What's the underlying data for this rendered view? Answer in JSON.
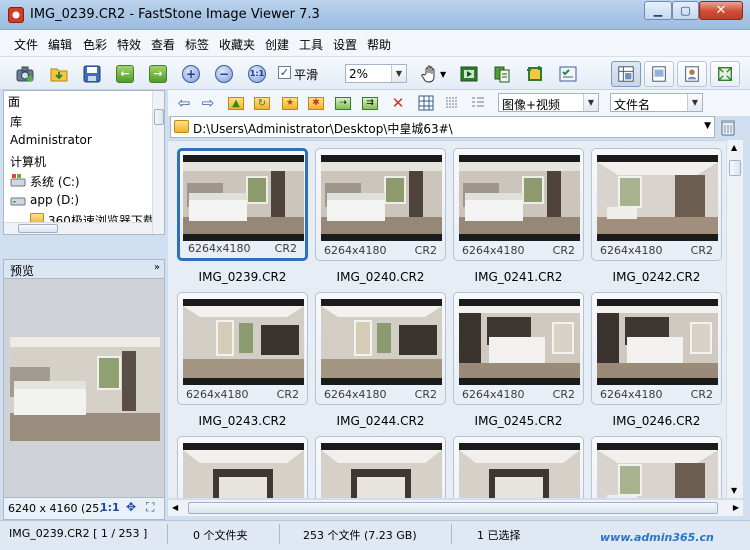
{
  "window": {
    "title": "IMG_0239.CR2  -  FastStone Image Viewer 7.3",
    "min_glyph": "▁",
    "max_glyph": "▢",
    "close_glyph": "✕"
  },
  "menu": [
    "文件",
    "编辑",
    "色彩",
    "特效",
    "查看",
    "标签",
    "收藏夹",
    "创建",
    "工具",
    "设置",
    "帮助"
  ],
  "toolbar": {
    "smooth_label": "平滑",
    "smooth_checked": true,
    "zoom_value": "2%",
    "zoom_fit_label": "1:1"
  },
  "tree": {
    "items": [
      {
        "label": "面",
        "icon": "none"
      },
      {
        "label": "库",
        "icon": "none"
      },
      {
        "label": "Administrator",
        "icon": "none"
      },
      {
        "label": "计算机",
        "icon": "none"
      },
      {
        "label": "系统 (C:)",
        "icon": "windows-drive-icon"
      },
      {
        "label": "app (D:)",
        "icon": "drive-icon"
      },
      {
        "label": "360极速浏览器下载",
        "icon": "folder-icon"
      }
    ]
  },
  "preview": {
    "header": "预览",
    "dims": "6240 x 4160 (25.",
    "ratio": "1:1"
  },
  "browser": {
    "filter_value": "图像+视频",
    "sort_value": "文件名",
    "path": "D:\\Users\\Administrator\\Desktop\\中皇城63#\\"
  },
  "thumbnails": [
    {
      "name": "IMG_0239.CR2",
      "res": "6264x4180",
      "type": "CR2",
      "selected": true
    },
    {
      "name": "IMG_0240.CR2",
      "res": "6264x4180",
      "type": "CR2"
    },
    {
      "name": "IMG_0241.CR2",
      "res": "6264x4180",
      "type": "CR2"
    },
    {
      "name": "IMG_0242.CR2",
      "res": "6264x4180",
      "type": "CR2"
    },
    {
      "name": "IMG_0243.CR2",
      "res": "6264x4180",
      "type": "CR2"
    },
    {
      "name": "IMG_0244.CR2",
      "res": "6264x4180",
      "type": "CR2"
    },
    {
      "name": "IMG_0245.CR2",
      "res": "6264x4180",
      "type": "CR2"
    },
    {
      "name": "IMG_0246.CR2",
      "res": "6264x4180",
      "type": "CR2"
    },
    {
      "name": "",
      "res": "",
      "type": ""
    },
    {
      "name": "",
      "res": "",
      "type": ""
    },
    {
      "name": "",
      "res": "",
      "type": ""
    },
    {
      "name": "",
      "res": "",
      "type": ""
    }
  ],
  "status": {
    "current_file": "IMG_0239.CR2 [ 1 / 253 ]",
    "folders": "0 个文件夹",
    "files": "253 个文件 (7.23 GB)",
    "selected": "1 已选择"
  },
  "watermark": "www.admin365.cn",
  "colors": {
    "accent": "#2f6fbf",
    "title_bar": "#a9c6e6",
    "close_button": "#cf4c36"
  }
}
